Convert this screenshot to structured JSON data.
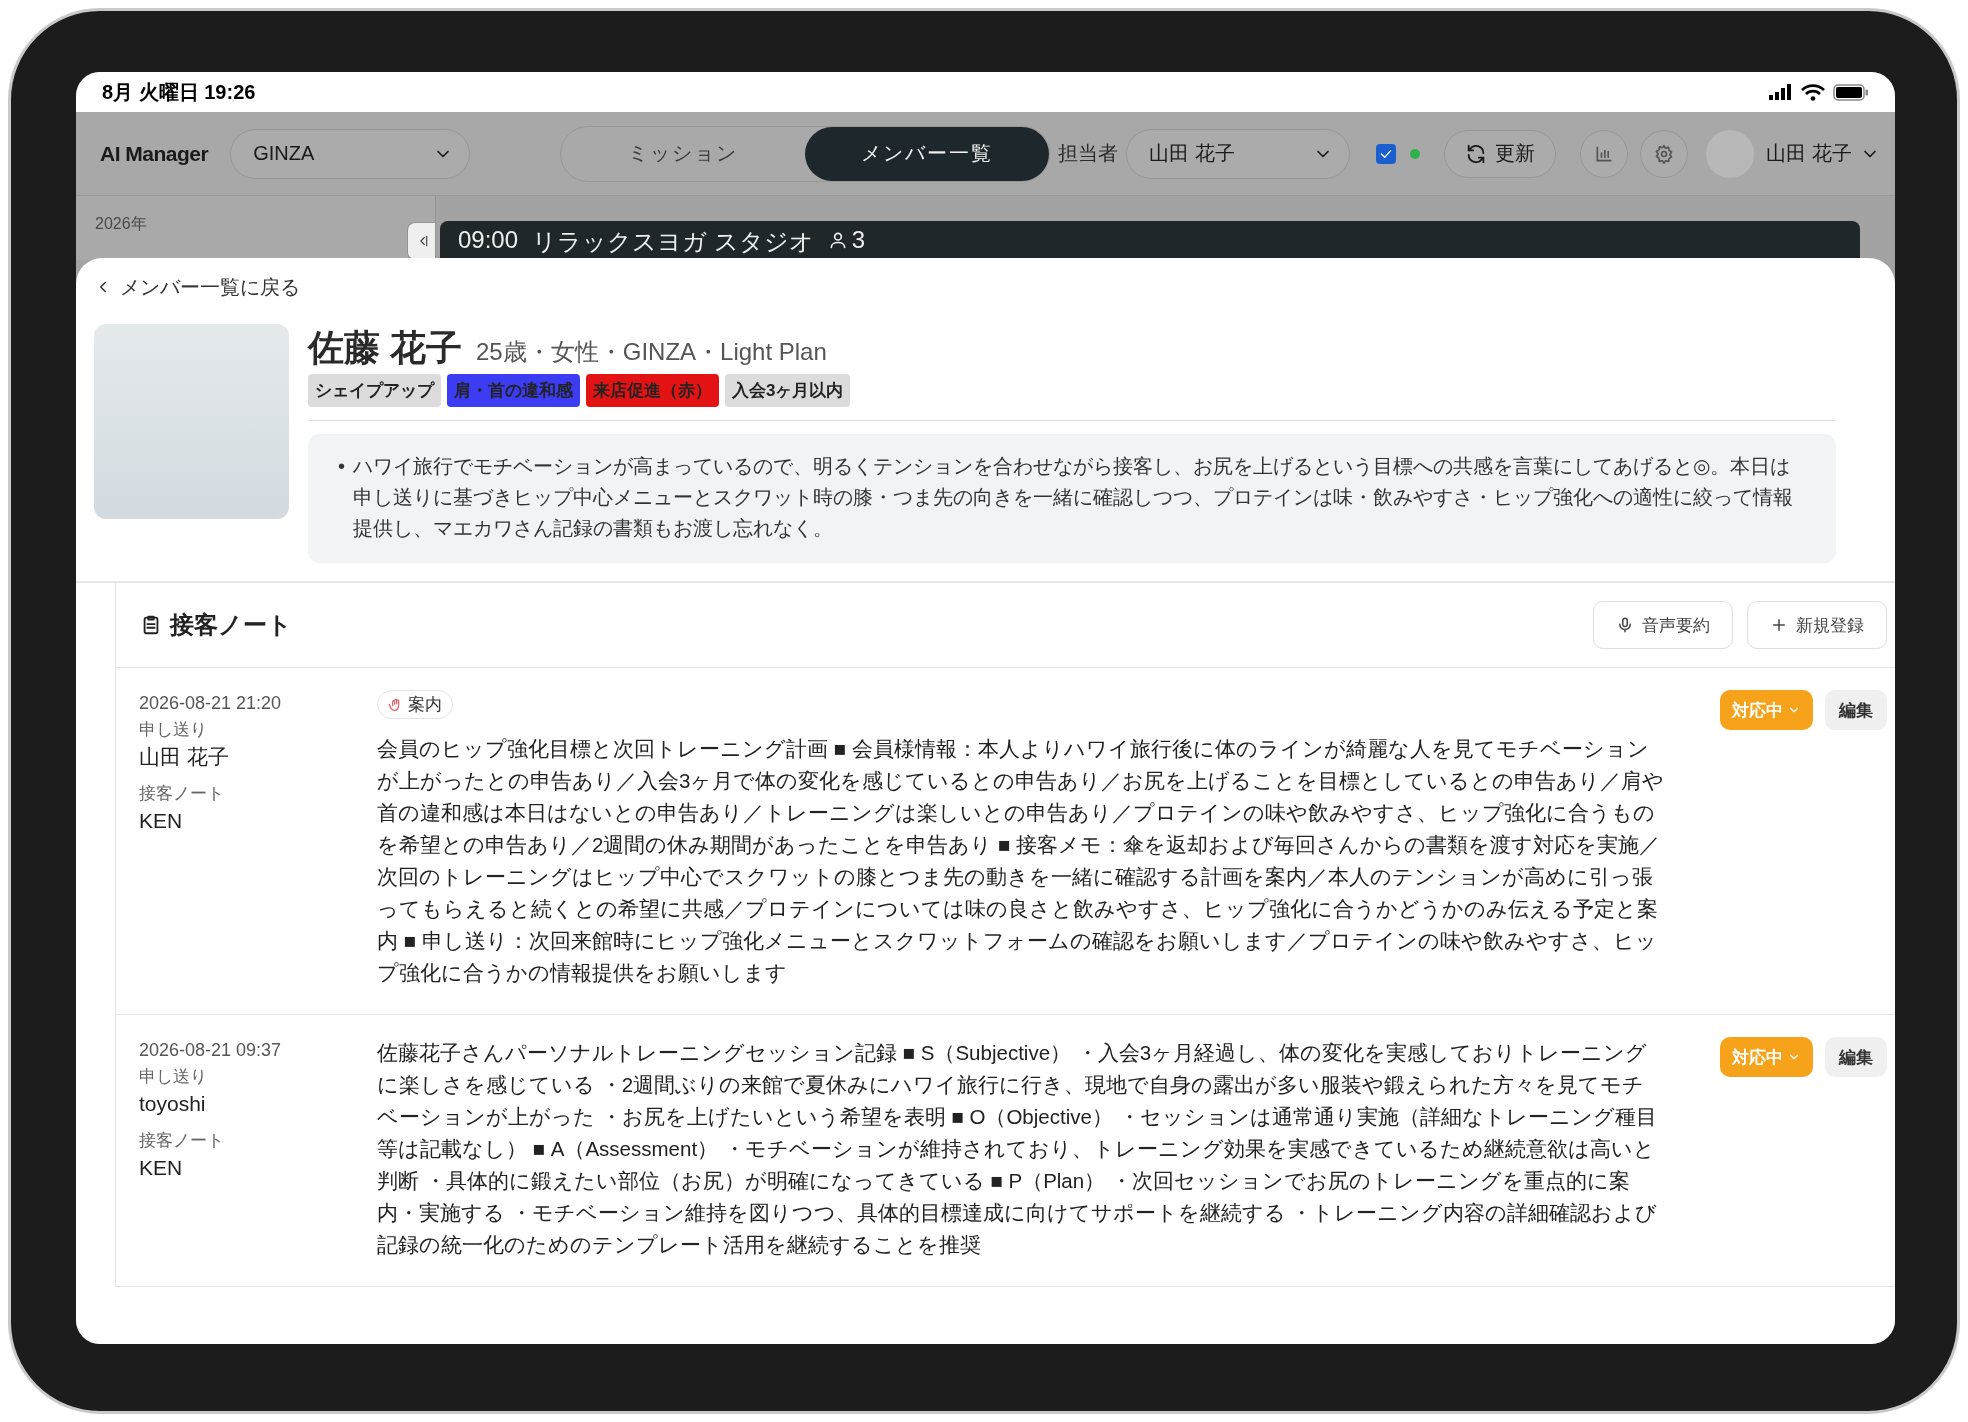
{
  "status_bar": {
    "time": "8月 火曜日 19:26"
  },
  "top_bar": {
    "app_name": "AI Manager",
    "store_select": "GINZA",
    "tabs": [
      {
        "label": "ミッション",
        "selected": false
      },
      {
        "label": "メンバー一覧",
        "selected": true
      }
    ],
    "staff_label": "担当者",
    "staff_select": "山田 花子",
    "filter_checked": true,
    "online": true,
    "refresh": "更新",
    "user_name": "山田 花子"
  },
  "background": {
    "year": "2026年",
    "schedule_time": "09:00",
    "schedule_title": "リラックスヨガ スタジオ",
    "schedule_count": "3"
  },
  "member": {
    "back": "メンバー一覧に戻る",
    "name": "佐藤 花子",
    "details": "25歳・女性・GINZA・Light Plan",
    "tags": [
      {
        "label": "シェイプアップ",
        "color": "#dcdcdc"
      },
      {
        "label": "肩・首の違和感",
        "color": "#3c3cf2"
      },
      {
        "label": "来店促進（赤）",
        "color": "#e31313"
      },
      {
        "label": "入会3ヶ月以内",
        "color": "#dcdcdc"
      }
    ],
    "bullet": "•",
    "summary": "ハワイ旅行でモチベーションが高まっているので、明るくテンションを合わせながら接客し、お尻を上げるという目標への共感を言葉にしてあげると◎。本日は申し送りに基づきヒップ中心メニューとスクワット時の膝・つま先の向きを一緒に確認しつつ、プロテインは味・飲みやすさ・ヒップ強化への適性に絞って情報提供し、マエカワさん記録の書類もお渡し忘れなく。"
  },
  "notes": {
    "title": "接客ノート",
    "voice_button": "音声要約",
    "new_button": "新規登録",
    "entries": [
      {
        "datetime": "2026-08-21 21:20",
        "handover_label": "申し送り",
        "handover_name": "山田 花子",
        "note_label": "接客ノート",
        "note_author": "KEN",
        "category": "案内",
        "body": "会員のヒップ強化目標と次回トレーニング計画 ■ 会員様情報：本人よりハワイ旅行後に体のラインが綺麗な人を見てモチベーションが上がったとの申告あり／入会3ヶ月で体の変化を感じているとの申告あり／お尻を上げることを目標としているとの申告あり／肩や首の違和感は本日はないとの申告あり／トレーニングは楽しいとの申告あり／プロテインの味や飲みやすさ、ヒップ強化に合うものを希望との申告あり／2週間の休み期間があったことを申告あり ■ 接客メモ：傘を返却および毎回さんからの書類を渡す対応を実施／次回のトレーニングはヒップ中心でスクワットの膝とつま先の動きを一緒に確認する計画を案内／本人のテンションが高めに引っ張ってもらえると続くとの希望に共感／プロテインについては味の良さと飲みやすさ、ヒップ強化に合うかどうかのみ伝える予定と案内 ■ 申し送り：次回来館時にヒップ強化メニューとスクワットフォームの確認をお願いします／プロテインの味や飲みやすさ、ヒップ強化に合うかの情報提供をお願いします",
        "status": "対応中",
        "edit": "編集"
      },
      {
        "datetime": "2026-08-21 09:37",
        "handover_label": "申し送り",
        "handover_name": "toyoshi",
        "note_label": "接客ノート",
        "note_author": "KEN",
        "body": "佐藤花子さんパーソナルトレーニングセッション記録 ■ S（Subjective） ・入会3ヶ月経過し、体の変化を実感しておりトレーニングに楽しさを感じている ・2週間ぶりの来館で夏休みにハワイ旅行に行き、現地で自身の露出が多い服装や鍛えられた方々を見てモチベーションが上がった ・お尻を上げたいという希望を表明 ■ O（Objective） ・セッションは通常通り実施（詳細なトレーニング種目等は記載なし） ■ A（Assessment） ・モチベーションが維持されており、トレーニング効果を実感できているため継続意欲は高いと判断 ・具体的に鍛えたい部位（お尻）が明確になってきている ■ P（Plan） ・次回セッションでお尻のトレーニングを重点的に案内・実施する ・モチベーション維持を図りつつ、具体的目標達成に向けてサポートを継続する ・トレーニング内容の詳細確認および記録の統一化のためのテンプレート活用を継続することを推奨",
        "status": "対応中",
        "edit": "編集"
      }
    ]
  }
}
